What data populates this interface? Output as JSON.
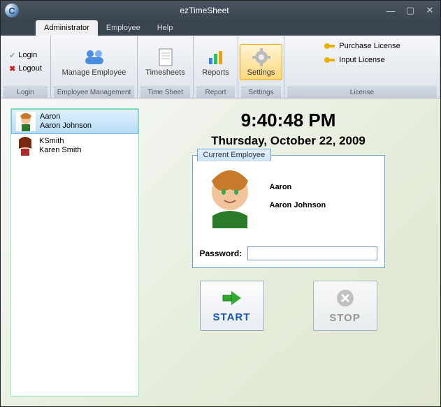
{
  "window": {
    "title": "ezTimeSheet"
  },
  "menu": {
    "administrator": "Administrator",
    "employee": "Employee",
    "help": "Help"
  },
  "ribbon": {
    "login": {
      "login": "Login",
      "logout": "Logout",
      "group": "Login"
    },
    "employee_mgmt": {
      "manage": "Manage Employee",
      "group": "Employee Management"
    },
    "timesheet": {
      "btn": "Timesheets",
      "group": "Time Sheet"
    },
    "report": {
      "btn": "Reports",
      "group": "Report"
    },
    "settings": {
      "btn": "Settings",
      "group": "Settings"
    },
    "license": {
      "purchase": "Purchase License",
      "input": "Input License",
      "group": "License"
    }
  },
  "employees": [
    {
      "short": "Aaron",
      "full": "Aaron Johnson",
      "selected": true
    },
    {
      "short": "KSmith",
      "full": "Karen Smith",
      "selected": false
    }
  ],
  "clock": {
    "time": "9:40:48 PM",
    "date": "Thursday, October 22, 2009"
  },
  "panel": {
    "title": "Current Employee",
    "short": "Aaron",
    "full": "Aaron Johnson",
    "password_label": "Password:",
    "password_value": ""
  },
  "buttons": {
    "start": "START",
    "stop": "STOP"
  }
}
